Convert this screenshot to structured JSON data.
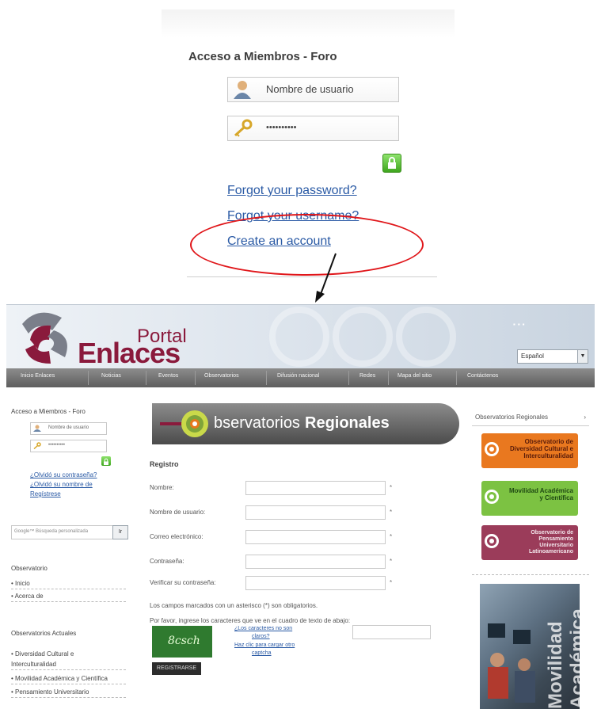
{
  "top_login": {
    "title": "Acceso a Miembros - Foro",
    "username_placeholder": "Nombre de usuario",
    "password_value": "••••••••••",
    "links": [
      "Forgot your password?",
      "Forgot your username?",
      "Create an account"
    ]
  },
  "colors": {
    "link": "#2a5aa5",
    "highlight": "#e0161a",
    "brand": "#8a1a3c",
    "nav": "#6d6d6d"
  },
  "portal": {
    "brand_top": "Portal",
    "brand_main": "Enlaces",
    "language": "Español",
    "nav": [
      "Inicio Enlaces",
      "Noticias",
      "Eventos",
      "Observatorios",
      "Difusión nacional",
      "Redes",
      "Mapa del sitio",
      "Contáctenos"
    ],
    "left": {
      "title": "Acceso a Miembros - Foro",
      "username_placeholder": "Nombre de usuario",
      "password_value": "••••••••••",
      "link_1": "¿Olvidó su contraseña?",
      "link_2": "¿Olvidó su nombre de",
      "link_3": "Regístrese",
      "search_placeholder": "Google™ Búsqueda personalizada",
      "search_button": "Ir",
      "obs_title": "Observatorio",
      "obs_items": [
        "Inicio",
        "Acerca de"
      ],
      "actual_title": "Observatorios Actuales",
      "actual_items": [
        "Diversidad Cultural e",
        "Interculturalidad",
        "Movilidad Académica y Científica",
        "Pensamiento Universitario"
      ]
    },
    "center": {
      "banner_a": "bservatorios",
      "banner_b": "Regionales",
      "form_title": "Registro",
      "fields": [
        "Nombre:",
        "Nombre de usuario:",
        "Correo electrónico:",
        "Contraseña:",
        "Verificar su contraseña:"
      ],
      "required_note": "Los campos marcados con un asterisco (*) son obligatorios.",
      "captcha_note": "Por favor, ingrese los caracteres que ve en el cuadro de texto de abajo:",
      "captcha_text": "8csch",
      "captcha_link_1": "¿Los caracteres no son",
      "captcha_link_2": "claros?",
      "captcha_link_3": "Haz clic para cargar otro",
      "captcha_link_4": "captcha",
      "register_button": "REGISTRARSE"
    },
    "right": {
      "title": "Observatorios Regionales",
      "cards": [
        {
          "name": "Observatorio de Diversidad Cultural e Interculturalidad",
          "color": "#e9781f"
        },
        {
          "name": "Movilidad Académica y Científica",
          "color": "#7cc242"
        },
        {
          "name": "Observatorio de Pensamiento Universitario Latinoamericano",
          "color": "#9b3c5a"
        }
      ],
      "photo_text": "Movilidad Académica"
    }
  }
}
